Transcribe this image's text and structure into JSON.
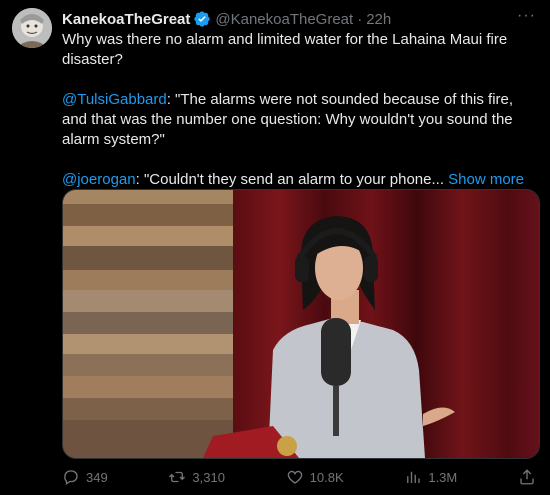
{
  "tweet": {
    "author_name": "KanekoaTheGreat",
    "handle": "@KanekoaTheGreat",
    "separator": "·",
    "time": "22h",
    "more_label": "···",
    "line1": "Why was there no alarm and limited water for the Lahaina Maui fire disaster?",
    "mention1": "@TulsiGabbard",
    "quote1": ": \"The alarms were not sounded because of this fire, and that was the number one question: Why wouldn't you sound the alarm system?\"",
    "mention2": "@joerogan",
    "quote2": ": \"Couldn't they send an alarm to your phone...",
    "show_more": "Show more"
  },
  "metrics": {
    "replies": "349",
    "reposts": "3,310",
    "likes": "10.8K",
    "views": "1.3M"
  },
  "colors": {
    "background": "#000000",
    "text": "#e7e9ea",
    "muted": "#71767b",
    "link": "#1d9bf0",
    "verified": "#1d9bf0"
  },
  "icons": [
    "verified-icon",
    "reply-icon",
    "repost-icon",
    "like-icon",
    "views-icon",
    "share-icon",
    "more-icon"
  ]
}
